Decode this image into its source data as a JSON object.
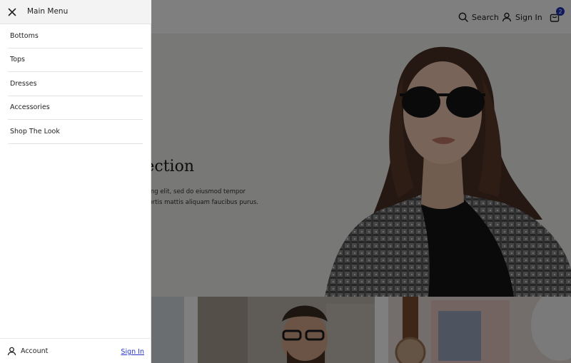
{
  "header": {
    "search_label": "Search",
    "search_icon": "search-icon",
    "signin_label": "Sign In",
    "user_icon": "user-icon",
    "cart_icon": "bag-icon",
    "cart_count": "2",
    "badge_color": "#1f35b8"
  },
  "hero": {
    "title_visible": "ection",
    "text_line1": "piscing elit, sed do eiusmod tempor",
    "text_line2": "Lobortis mattis aliquam faucibus purus.",
    "carousel_active_index": 1,
    "carousel_dot_count": 2
  },
  "drawer": {
    "title": "Main Menu",
    "close_icon": "close-icon",
    "items": [
      {
        "label": "Bottoms"
      },
      {
        "label": "Tops"
      },
      {
        "label": "Dresses"
      },
      {
        "label": "Accessories"
      },
      {
        "label": "Shop The Look"
      }
    ],
    "footer": {
      "account_label": "Account",
      "account_icon": "user-icon",
      "signin_label": "Sign In",
      "link_color": "#2536c9"
    }
  }
}
